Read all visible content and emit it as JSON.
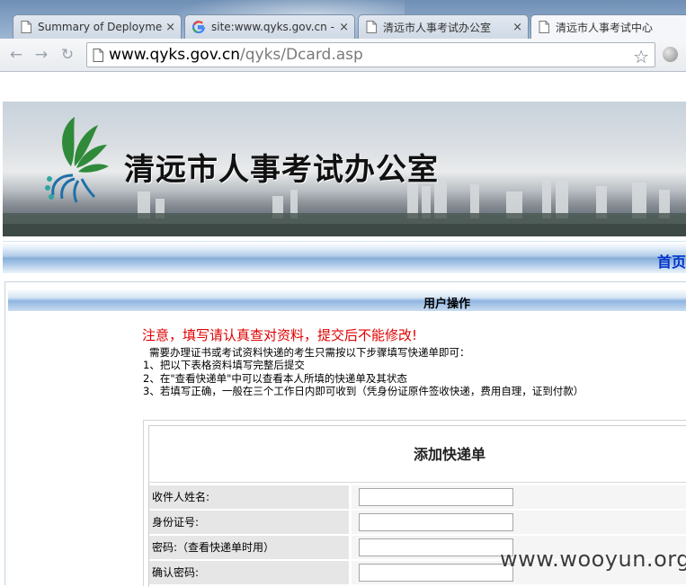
{
  "browser": {
    "tabs": [
      {
        "label": "Summary of Deploymen",
        "icon": "page-icon",
        "active": false
      },
      {
        "label": "site:www.qyks.gov.cn - G",
        "icon": "google-icon",
        "active": false
      },
      {
        "label": "清远市人事考试办公室",
        "icon": "page-icon",
        "active": false
      },
      {
        "label": "清远市人事考试中心",
        "icon": "page-icon",
        "active": true
      }
    ],
    "tab_close": "×",
    "back_glyph": "←",
    "forward_glyph": "→",
    "reload_glyph": "↻",
    "url_host": "www.qyks.gov.cn",
    "url_path": "/qyks/Dcard.asp",
    "star_glyph": "☆"
  },
  "banner": {
    "site_title": "清远市人事考试办公室"
  },
  "nav": {
    "home": "首页"
  },
  "panel": {
    "title": "用户操作",
    "notice": "注意，填写请认真查对资料，提交后不能修改!",
    "lead": "需要办理证书或考试资料快递的考生只需按以下步骤填写快递单即可：",
    "steps": [
      "1、把以下表格资料填写完整后提交",
      "2、在\"查看快递单\"中可以查看本人所填的快递单及其状态",
      "3、若填写正确，一般在三个工作日内即可收到（凭身份证原件签收快递，费用自理，证到付款）"
    ]
  },
  "form": {
    "title": "添加快递单",
    "fields": [
      {
        "label": "收件人姓名:",
        "value": ""
      },
      {
        "label": "身份证号:",
        "value": ""
      },
      {
        "label": "密码:（查看快递单时用）",
        "value": ""
      },
      {
        "label": "确认密码:",
        "value": ""
      }
    ]
  },
  "watermark": "www.wooyun.org"
}
